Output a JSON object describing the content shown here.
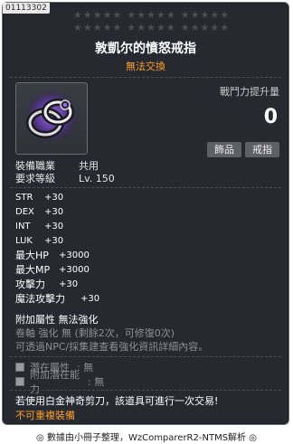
{
  "item": {
    "id": "01113302",
    "name": "敦凱尔的憤怒戒指",
    "trade_note": "無法交換",
    "star_rows": [
      [
        5,
        5,
        5
      ],
      [
        5,
        5,
        5
      ]
    ],
    "icon": "ring-icon"
  },
  "combat_power": {
    "label": "戰鬥力提升量",
    "value": "0"
  },
  "tags": [
    "飾品",
    "戒指"
  ],
  "requirements": {
    "job_label": "裝備職業",
    "job_value": "共用",
    "level_label": "要求等級",
    "level_value": "Lv. 150"
  },
  "stats": [
    {
      "label": "STR",
      "value": "+30"
    },
    {
      "label": "DEX",
      "value": "+30"
    },
    {
      "label": "INT",
      "value": "+30"
    },
    {
      "label": "LUK",
      "value": "+30"
    },
    {
      "label": "最大HP",
      "value": "+3000"
    },
    {
      "label": "最大MP",
      "value": "+3000"
    },
    {
      "label": "攻擊力",
      "value": "+30"
    },
    {
      "label": "魔法攻擊力",
      "value": "+30"
    }
  ],
  "enhancement": {
    "extra_attr": "附加屬性  無法強化",
    "scroll": "卷軸 強化 無 (剩餘2次，可修復0次)",
    "hint": "可透過NPC/採集建查看強化資訊詳細內容。"
  },
  "potential": {
    "potential_label": "潛在屬性",
    "potential_value": ": 無",
    "additional_label": "附加潛在能力",
    "additional_value": ": 無"
  },
  "scissors_note": "若使用白金神奇剪刀，該道具可進行一次交易!",
  "unrepeatable": "不可重複裝備",
  "footer": "◎ 數據由小冊子整理，WzComparerR2-NTMS解析 ◎",
  "colors": {
    "panel": "#26292f",
    "orange": "#ff9f2e",
    "dim": "#8d8f94",
    "tag_bg": "#5e6066"
  }
}
